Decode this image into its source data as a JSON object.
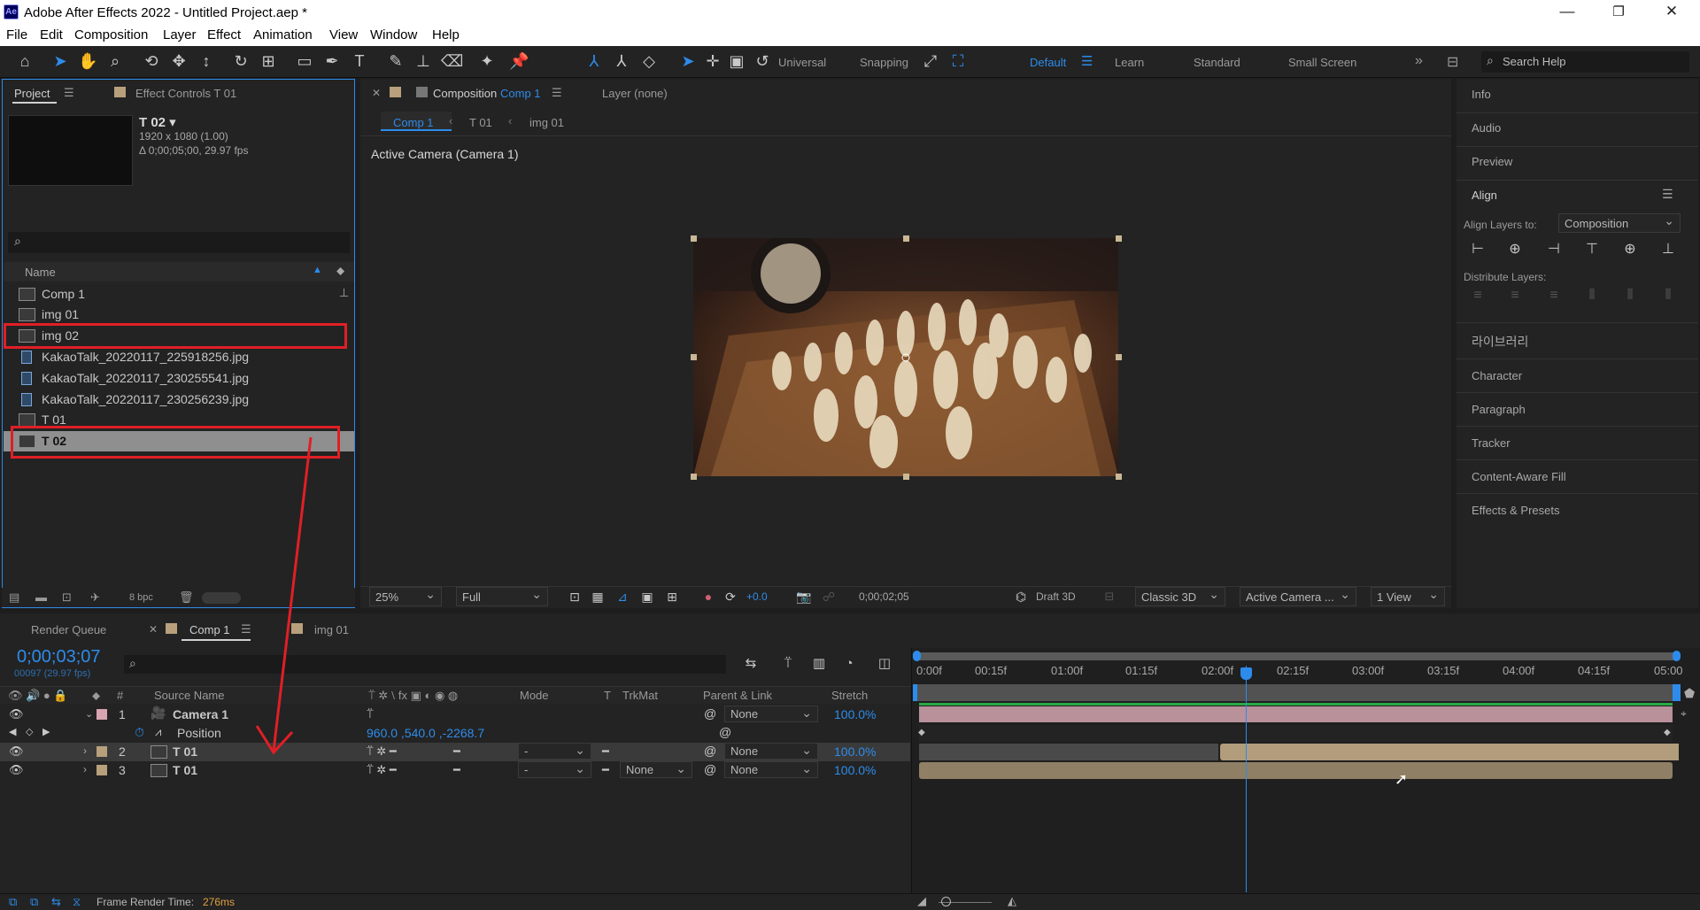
{
  "window": {
    "app_logo": "Ae",
    "title": "Adobe After Effects 2022 - Untitled Project.aep *",
    "minimize_icon": "minimize-icon",
    "restore_icon": "restore-icon",
    "close_icon": "close-icon"
  },
  "menu": [
    "File",
    "Edit",
    "Composition",
    "Layer",
    "Effect",
    "Animation",
    "View",
    "Window",
    "Help"
  ],
  "toolbar": {
    "axis_mode": "Universal",
    "snapping": "Snapping",
    "workspaces": [
      "Default",
      "Learn",
      "Standard",
      "Small Screen"
    ],
    "active_workspace": "Default",
    "search_help_placeholder": "Search Help"
  },
  "project_panel": {
    "tab_project": "Project",
    "tab_effect_controls": "Effect Controls  T 01",
    "selected_name": "T 02 ▾",
    "selected_dims": "1920 x 1080 (1.00)",
    "selected_duration": "Δ 0;00;05;00, 29.97 fps",
    "column_name": "Name",
    "items": [
      {
        "name": "Comp 1",
        "type": "comp"
      },
      {
        "name": "img 01",
        "type": "comp"
      },
      {
        "name": "img 02",
        "type": "comp"
      },
      {
        "name": "KakaoTalk_20220117_225918256.jpg",
        "type": "image"
      },
      {
        "name": "KakaoTalk_20220117_230255541.jpg",
        "type": "image"
      },
      {
        "name": "KakaoTalk_20220117_230256239.jpg",
        "type": "image"
      },
      {
        "name": "T 01",
        "type": "comp"
      },
      {
        "name": "T 02",
        "type": "comp"
      }
    ],
    "bpc": "8 bpc"
  },
  "composition_panel": {
    "tab_label": "Composition",
    "tab_comp": "Comp 1",
    "layer_tab": "Layer (none)",
    "breadcrumbs": [
      "Comp 1",
      "T 01",
      "img 01"
    ],
    "camera_label": "Active Camera (Camera 1)",
    "zoom": "25%",
    "resolution": "Full",
    "exposure": "+0.0",
    "timecode": "0;00;02;05",
    "draft3d": "Draft 3D",
    "renderer": "Classic 3D",
    "camera_select": "Active Camera ...",
    "views": "1 View"
  },
  "right_panel": {
    "items_top": [
      "Info",
      "Audio",
      "Preview"
    ],
    "align_title": "Align",
    "align_layers_to_label": "Align Layers to:",
    "align_layers_to_value": "Composition",
    "distribute_label": "Distribute Layers:",
    "items_bottom": [
      "라이브러리",
      "Character",
      "Paragraph",
      "Tracker",
      "Content-Aware Fill",
      "Effects & Presets"
    ]
  },
  "timeline": {
    "tab_render_queue": "Render Queue",
    "tab_comp": "Comp 1",
    "tab_img": "img 01",
    "timecode": "0;00;03;07",
    "frame_info": "00097 (29.97 fps)",
    "columns": {
      "hash": "#",
      "source": "Source Name",
      "mode": "Mode",
      "t": "T",
      "trkmat": "TrkMat",
      "parent": "Parent & Link",
      "stretch": "Stretch"
    },
    "ruler": [
      "0:00f",
      "00:15f",
      "01:00f",
      "01:15f",
      "02:00f",
      "02:15f",
      "03:00f",
      "03:15f",
      "04:00f",
      "04:15f",
      "05:00"
    ],
    "layers": [
      {
        "num": "1",
        "name": "Camera 1",
        "mode": "",
        "trkmat": "",
        "parent": "None",
        "stretch": "100.0%"
      },
      {
        "num": "2",
        "name": "T 01",
        "mode": "-",
        "trkmat": "",
        "parent": "None",
        "stretch": "100.0%"
      },
      {
        "num": "3",
        "name": "T 01",
        "mode": "-",
        "trkmat": "None",
        "parent": "None",
        "stretch": "100.0%"
      }
    ],
    "position_prop": "Position",
    "position_value": "960.0 ,540.0 ,-2268.7",
    "frame_render_label": "Frame Render Time:",
    "frame_render_value": "276ms"
  },
  "colors": {
    "accent": "#2d8ceb",
    "annotation_red": "#e01f26",
    "camera_layer": "#d9a3b0",
    "footage_layer": "#b8a07c"
  }
}
